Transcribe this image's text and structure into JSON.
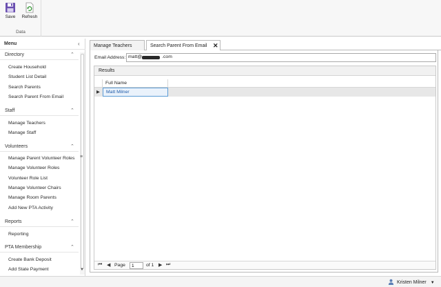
{
  "ribbon": {
    "save_label": "Save",
    "refresh_label": "Refresh",
    "group_label": "Data"
  },
  "sidebar": {
    "title": "Menu",
    "sections": [
      {
        "title": "Directory",
        "items": [
          "Create Household",
          "Student List Detail",
          "Search Parents",
          "Search Parent From Email"
        ]
      },
      {
        "title": "Staff",
        "items": [
          "Manage Teachers",
          "Manage Staff"
        ]
      },
      {
        "title": "Volunteers",
        "items": [
          "Manage Parent Volunteer Roles",
          "Manage Volunteer Roles",
          "Volunteer Role List",
          "Manage Volunteer Chairs",
          "Manage Room Parents",
          "Add New PTA Activity"
        ]
      },
      {
        "title": "Reports",
        "items": [
          "Reporting"
        ]
      },
      {
        "title": "PTA Membership",
        "items": [
          "Create Bank Deposit",
          "Add State Payment"
        ]
      }
    ]
  },
  "tabs": [
    {
      "label": "Manage Teachers",
      "active": false
    },
    {
      "label": "Search Parent From Email",
      "active": true
    }
  ],
  "search": {
    "email_label": "Email Address:",
    "email_value_prefix": "matt@",
    "email_value_suffix": ".com"
  },
  "results": {
    "title": "Results",
    "columns": [
      "Full Name"
    ],
    "rows": [
      [
        "Matt Milner"
      ]
    ]
  },
  "pager": {
    "page_label": "Page",
    "page_value": "1",
    "of_label": "of 1"
  },
  "status": {
    "user_name": "Kristen Milner"
  },
  "colors": {
    "accent": "#5b9bd5",
    "link_text": "#1d5aa8",
    "save_icon": "#6a4fb0",
    "refresh_icon": "#3c9a3c"
  }
}
